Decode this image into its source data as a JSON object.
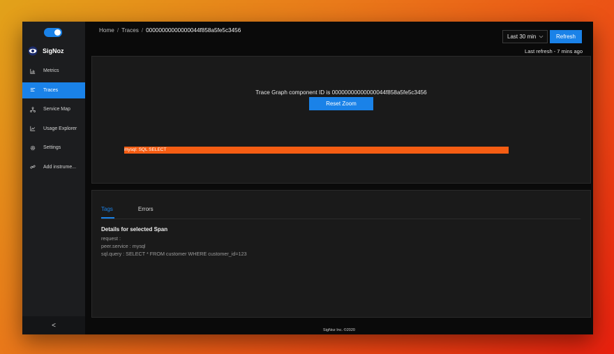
{
  "app": {
    "brand_name": "SigNoz",
    "accent_color": "#1a82e8",
    "span_color": "#f55d13"
  },
  "sidebar": {
    "items": [
      {
        "label": "Metrics",
        "icon": "bar-chart-icon",
        "active": false
      },
      {
        "label": "Traces",
        "icon": "list-align-icon",
        "active": true
      },
      {
        "label": "Service Map",
        "icon": "deployment-unit-icon",
        "active": false
      },
      {
        "label": "Usage Explorer",
        "icon": "line-chart-icon",
        "active": false
      },
      {
        "label": "Settings",
        "icon": "gear-icon",
        "active": false
      },
      {
        "label": "Add instrume...",
        "icon": "link-icon",
        "active": false
      }
    ],
    "collapse_icon": "chevron-left-icon",
    "collapse_glyph": "<"
  },
  "header": {
    "breadcrumb": [
      "Home",
      "Traces",
      "00000000000000044f858a5fe5c3456"
    ],
    "separator": "/",
    "time_range": "Last 30 min",
    "refresh_label": "Refresh",
    "last_refresh": "Last refresh - 7 mins ago"
  },
  "graph": {
    "title": "Trace Graph component ID is 00000000000000044f858a5fe5c3456",
    "reset_label": "Reset Zoom",
    "span_label": "mysql: SQL SELECT"
  },
  "details": {
    "tabs": [
      {
        "label": "Tags",
        "active": true
      },
      {
        "label": "Errors",
        "active": false
      }
    ],
    "heading": "Details for selected Span",
    "lines": [
      "request :",
      "peer.service : mysql",
      "sql.query : SELECT * FROM customer WHERE customer_id=123"
    ]
  },
  "footer": {
    "text": "SigNoz Inc. ©2020"
  }
}
